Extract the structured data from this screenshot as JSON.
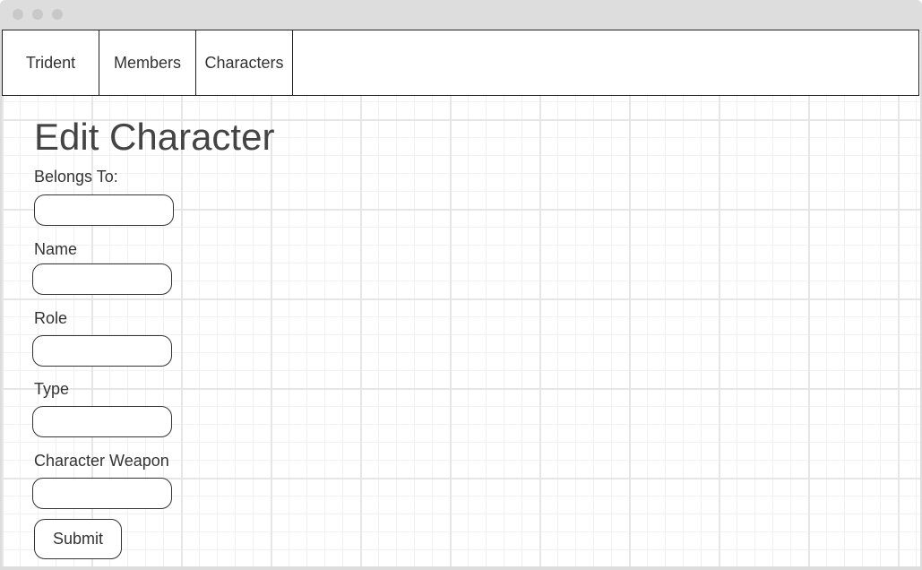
{
  "nav": {
    "items": [
      {
        "label": "Trident"
      },
      {
        "label": "Members"
      },
      {
        "label": "Characters"
      }
    ]
  },
  "page": {
    "title": "Edit Character"
  },
  "form": {
    "fields": [
      {
        "label": "Belongs To:",
        "value": "",
        "placeholder": ""
      },
      {
        "label": "Name",
        "value": "",
        "placeholder": ""
      },
      {
        "label": "Role",
        "value": "",
        "placeholder": ""
      },
      {
        "label": "Type",
        "value": "",
        "placeholder": ""
      },
      {
        "label": "Character Weapon",
        "value": "",
        "placeholder": ""
      }
    ],
    "submit_label": "Submit"
  }
}
